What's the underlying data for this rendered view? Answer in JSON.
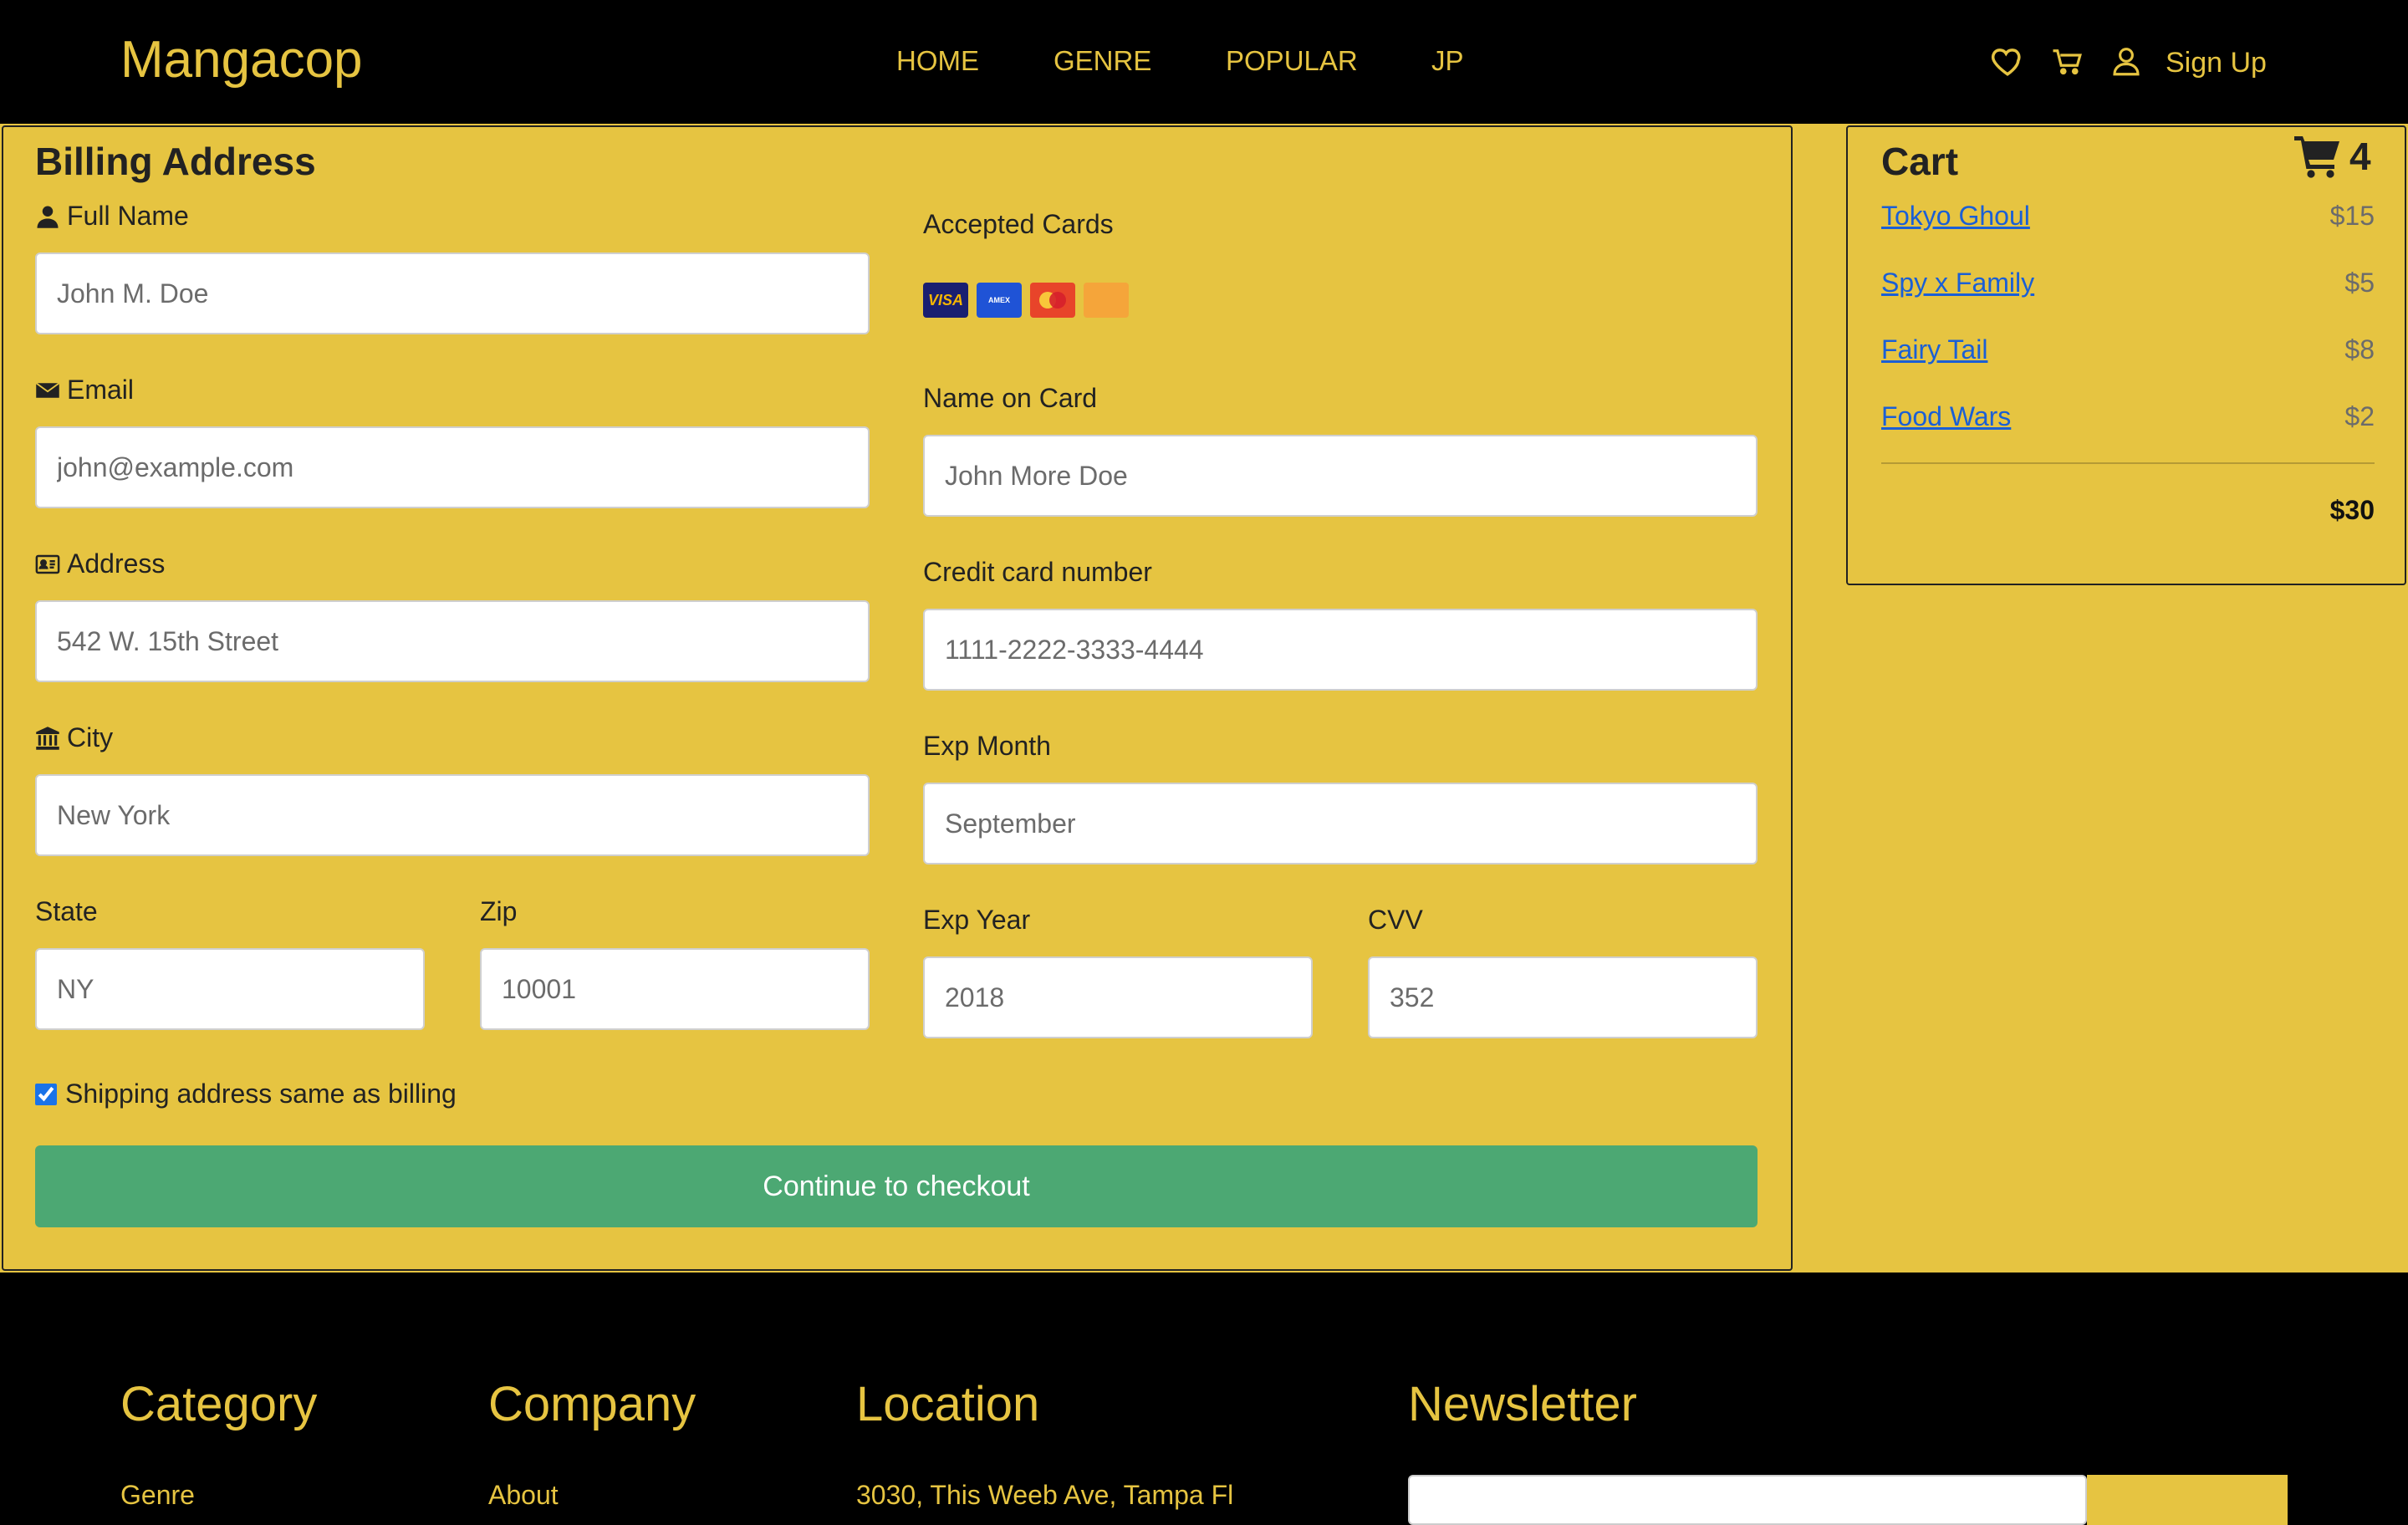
{
  "header": {
    "brand": "Mangacop",
    "nav": [
      "HOME",
      "GENRE",
      "POPULAR",
      "JP"
    ],
    "sign_up": "Sign Up"
  },
  "billing": {
    "title": "Billing Address",
    "full_name": {
      "label": "Full Name",
      "placeholder": "John M. Doe"
    },
    "email": {
      "label": "Email",
      "placeholder": "john@example.com"
    },
    "address": {
      "label": "Address",
      "placeholder": "542 W. 15th Street"
    },
    "city": {
      "label": "City",
      "placeholder": "New York"
    },
    "state": {
      "label": "State",
      "placeholder": "NY"
    },
    "zip": {
      "label": "Zip",
      "placeholder": "10001"
    }
  },
  "payment": {
    "accepted_cards_label": "Accepted Cards",
    "cards": [
      "VISA",
      "AMEX",
      "MASTERCARD",
      "DISCOVER"
    ],
    "name_on_card": {
      "label": "Name on Card",
      "placeholder": "John More Doe"
    },
    "card_number": {
      "label": "Credit card number",
      "placeholder": "1111-2222-3333-4444"
    },
    "exp_month": {
      "label": "Exp Month",
      "placeholder": "September"
    },
    "exp_year": {
      "label": "Exp Year",
      "placeholder": "2018"
    },
    "cvv": {
      "label": "CVV",
      "placeholder": "352"
    }
  },
  "same_address": {
    "label": "Shipping address same as billing",
    "checked": true
  },
  "checkout_button": "Continue to checkout",
  "cart": {
    "title": "Cart",
    "count": "4",
    "items": [
      {
        "name": "Tokyo Ghoul",
        "price": "$15"
      },
      {
        "name": "Spy x Family",
        "price": "$5"
      },
      {
        "name": "Fairy Tail",
        "price": "$8"
      },
      {
        "name": "Food Wars",
        "price": "$2"
      }
    ],
    "total": "$30"
  },
  "footer": {
    "category": {
      "title": "Category",
      "first_link": "Genre"
    },
    "company": {
      "title": "Company",
      "first_link": "About"
    },
    "location": {
      "title": "Location",
      "address": "3030, This Weeb Ave, Tampa Fl"
    },
    "newsletter": {
      "title": "Newsletter"
    }
  },
  "colors": {
    "accent": "#e6c441",
    "background": "#000000",
    "checkout": "#4ca873",
    "link": "#1a5fd6"
  }
}
